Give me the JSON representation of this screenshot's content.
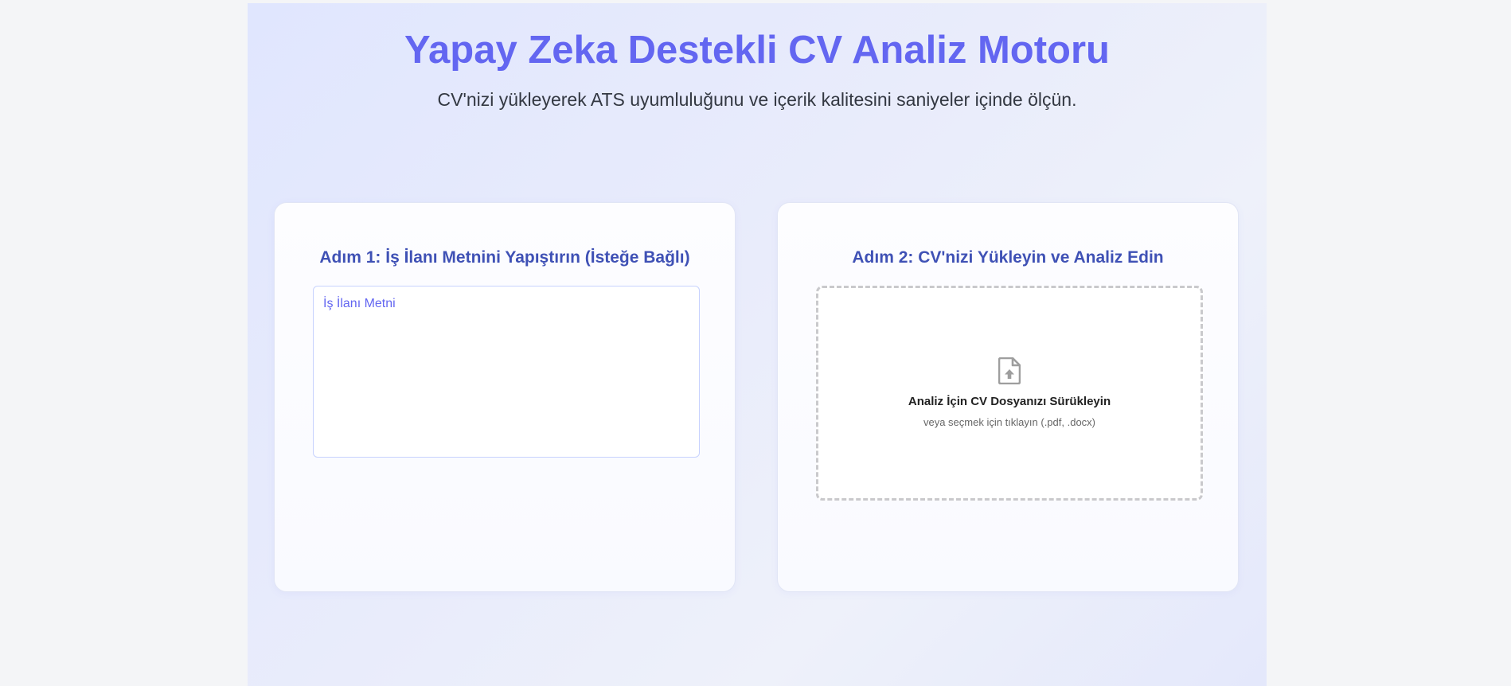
{
  "header": {
    "title": "Yapay Zeka Destekli CV Analiz Motoru",
    "subtitle": "CV'nizi yükleyerek ATS uyumluluğunu ve içerik kalitesini saniyeler içinde ölçün."
  },
  "step1": {
    "heading": "Adım 1: İş İlanı Metnini Yapıştırın (İsteğe Bağlı)",
    "textarea_value": "",
    "textarea_placeholder": "İş İlanı Metni"
  },
  "step2": {
    "heading": "Adım 2: CV'nizi Yükleyin ve Analiz Edin",
    "dropzone": {
      "icon": "file-upload-icon",
      "title": "Analiz İçin CV Dosyanızı Sürükleyin",
      "hint": "veya seçmek için tıklayın (.pdf, .docx)"
    }
  },
  "colors": {
    "accent": "#6366f1",
    "heading": "#3f51b5",
    "page_background": "#f4f5f7",
    "panel_background": "#e4e9fc",
    "icon": "#9e9e9e"
  }
}
